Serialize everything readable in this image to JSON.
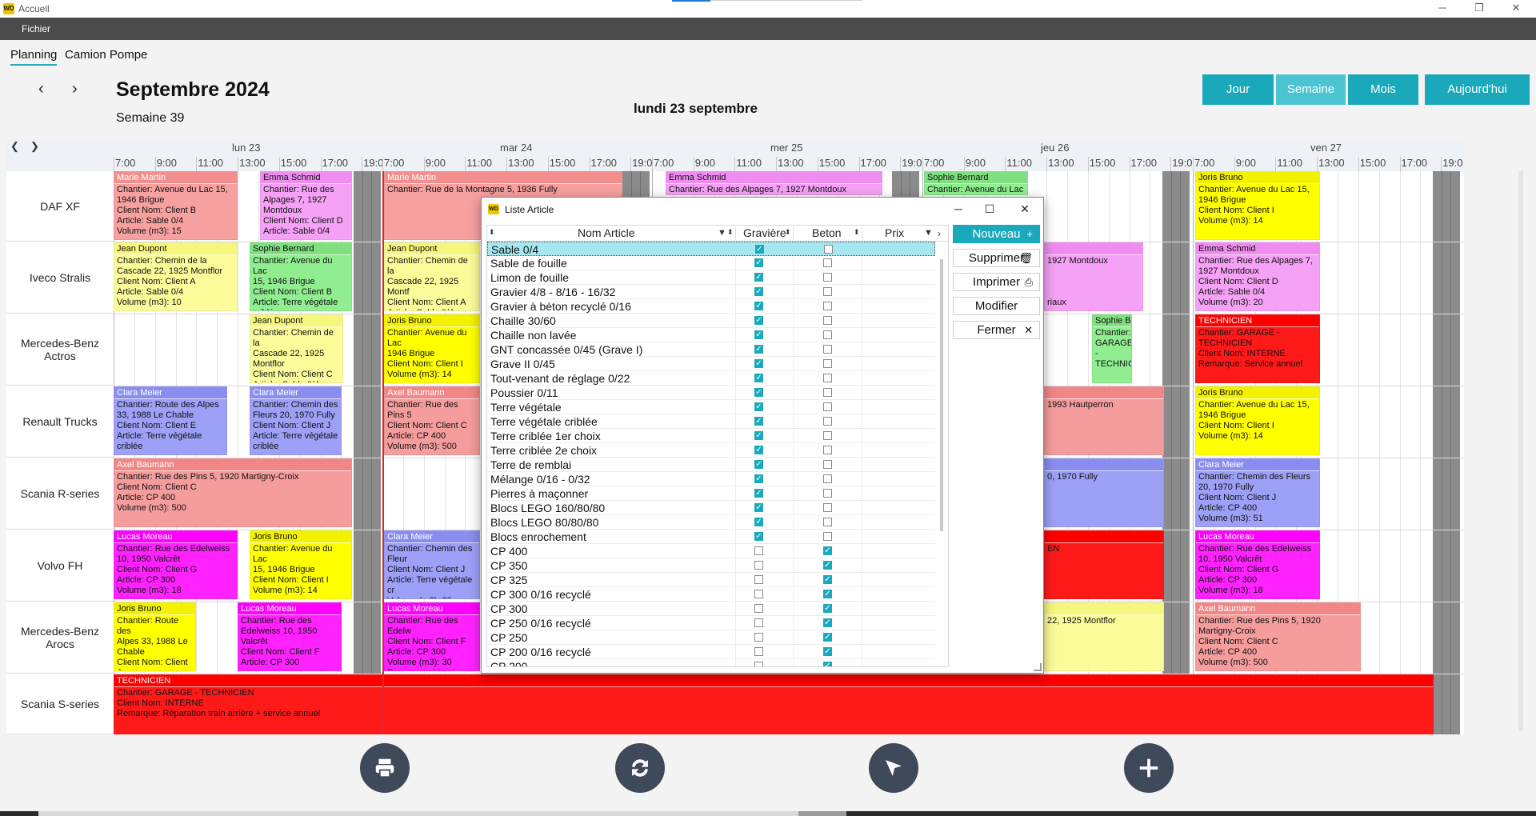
{
  "window": {
    "title": "Accueil",
    "logo": "WD"
  },
  "menu": {
    "file": "Fichier"
  },
  "tabs": [
    "Planning",
    "Camion Pompe"
  ],
  "header": {
    "month": "Septembre 2024",
    "week": "Semaine 39",
    "current_day": "lundi 23 septembre",
    "prev_icon": "‹",
    "next_icon": "›",
    "views": [
      "Jour",
      "Semaine",
      "Mois",
      "Aujourd'hui"
    ],
    "selected_view": "Semaine"
  },
  "grid": {
    "days": [
      "lun 23",
      "mar 24",
      "mer 25",
      "jeu 26",
      "ven 27"
    ],
    "hours": [
      "7:00",
      "9:00",
      "11:00",
      "13:00",
      "15:00",
      "17:00",
      "19:0"
    ],
    "rows": [
      "DAF XF",
      "Iveco Stralis",
      "Mercedes-Benz Actros",
      "Renault Trucks",
      "Scania R-series",
      "Volvo FH",
      "Mercedes-Benz Arocs",
      "Scania S-series"
    ]
  },
  "events": [
    {
      "name": "Marie Martin",
      "body": "Chantier: Avenue du Lac 15,\n1946 Brigue\nClient Nom: Client B\nArticle: Sable 0/4\nVolume (m3): 15",
      "color": "pink"
    },
    {
      "name": "Emma Schmid",
      "body": "Chantier: Rue des\nAlpages 7, 1927\nMontdoux\nClient Nom: Client D\nArticle: Sable 0/4",
      "color": "magenta"
    },
    {
      "name": "Marie Martin",
      "body": "Chantier: Rue de la Montagne 5, 1936 Fully",
      "color": "pink"
    },
    {
      "name": "Emma Schmid",
      "body": "Chantier: Rue des Alpages 7, 1927 Montdoux",
      "color": "magenta"
    },
    {
      "name": "Sophie Bernard",
      "body": "Chantier: Avenue du Lac",
      "color": "green"
    },
    {
      "name": "Joris Bruno",
      "body": "Chantier: Avenue du Lac 15,\n1946 Brigue\nClient Nom: Client I\nVolume (m3): 14",
      "color": "yellow"
    },
    {
      "name": "Jean Dupont",
      "body": "Chantier: Chemin de la\nCascade 22, 1925 Montflor\nClient Nom: Client A\nArticle: Sable 0/4\nVolume (m3): 10",
      "color": "paleyellow"
    },
    {
      "name": "Sophie Bernard",
      "body": "Chantier: Avenue du Lac\n15, 1946 Brigue\nClient Nom: Client B\nArticle: Terre végétale\ncriblée",
      "color": "green"
    },
    {
      "name": "Jean Dupont",
      "body": "Chantier: Chemin de la\nCascade 22, 1925 Montf\nClient Nom: Client A\nArticle: Sable 0/4\nVolume (m3): 10",
      "color": "paleyellow"
    },
    {
      "name": "",
      "body": "1927 Montdoux\n\n\n\nriaux",
      "color": "magenta"
    },
    {
      "name": "Emma Schmid",
      "body": "Chantier: Rue des Alpages 7,\n1927 Montdoux\nClient Nom: Client D\nArticle: Sable 0/4\nVolume (m3): 20",
      "color": "magenta"
    },
    {
      "name": "Jean Dupont",
      "body": "Chantier: Chemin de la\nCascade 22, 1925\nMontflor\nClient Nom: Client C\nArticle: Sable 0/4",
      "color": "paleyellow"
    },
    {
      "name": "Joris Bruno",
      "body": "Chantier: Avenue du Lac\n1946 Brigue\nClient Nom: Client I\nVolume (m3): 14",
      "color": "yellow"
    },
    {
      "name": "Sophie Bernard",
      "body": "Chantier:\nGARAGE\n-\nTECHNICI",
      "color": "green"
    },
    {
      "name": "TECHNICIEN",
      "body": "Chantier: GARAGE -\nTECHNICIEN\nClient Nom: INTERNE\nRemarque: Service annuel",
      "color": "red"
    },
    {
      "name": "Clara Meier",
      "body": "Chantier: Route des Alpes\n33, 1988 Le Chable\nClient Nom: Client E\nArticle: Terre végétale\ncriblée",
      "color": "blue"
    },
    {
      "name": "Clara Meier",
      "body": "Chantier: Chemin des\nFleurs 20, 1970 Fully\nClient Nom: Client J\nArticle: Terre végétale\ncriblée",
      "color": "blue"
    },
    {
      "name": "Axel Baumann",
      "body": "Chantier: Rue des Pins 5\nClient Nom: Client C\nArticle: CP 400\nVolume (m3): 500",
      "color": "salmon"
    },
    {
      "name": "",
      "body": "1993 Hautperron",
      "color": "salmon"
    },
    {
      "name": "Joris Bruno",
      "body": "Chantier: Avenue du Lac 15,\n1946 Brigue\nClient Nom: Client I\nVolume (m3): 14",
      "color": "yellow"
    },
    {
      "name": "Axel Baumann",
      "body": "Chantier: Rue des Pins 5, 1920 Martigny-Croix\nClient Nom: Client C\nArticle: CP 400\nVolume (m3): 500",
      "color": "salmon"
    },
    {
      "name": "",
      "body": "0, 1970 Fully",
      "color": "blue"
    },
    {
      "name": "Clara Meier",
      "body": "Chantier: Chemin des Fleurs\n20, 1970 Fully\nClient Nom: Client J\nArticle: CP 400\nVolume (m3): 51",
      "color": "blue"
    },
    {
      "name": "Lucas Moreau",
      "body": "Chantier: Rue des Edelweiss\n10, 1950 Valcrêt\nClient Nom: Client G\nArticle: CP 300\nVolume (m3): 18",
      "color": "hotpink"
    },
    {
      "name": "Joris Bruno",
      "body": "Chantier: Avenue du Lac\n15, 1946 Brigue\nClient Nom: Client I\nVolume (m3): 14",
      "color": "yellow"
    },
    {
      "name": "Clara Meier",
      "body": "Chantier: Chemin des Fleur\nClient Nom: Client J\nArticle: Terre végétale cr\nVolume (m3): 28\nRemarque: Livraison de",
      "color": "blue"
    },
    {
      "name": "",
      "body": "EN",
      "color": "red"
    },
    {
      "name": "Lucas Moreau",
      "body": "Chantier: Rue des Edelweiss\n10, 1950 Valcrêt\nClient Nom: Client G\nArticle: CP 300\nVolume (m3): 18",
      "color": "hotpink"
    },
    {
      "name": "Joris Bruno",
      "body": "Chantier: Route des\nAlpes 33, 1988 Le\nChable\nClient Nom: Client A\nArticle: Sable 0/4",
      "color": "yellow"
    },
    {
      "name": "Lucas Moreau",
      "body": "Chantier: Rue des\nEdelweiss 10, 1950\nValcrêt\nClient Nom: Client F\nArticle: CP 300",
      "color": "hotpink"
    },
    {
      "name": "Lucas Moreau",
      "body": "Chantier: Rue des Edelw\nClient Nom: Client F\nArticle: CP 300\nVolume (m3): 30\nRemarque: Livraison de",
      "color": "hotpink"
    },
    {
      "name": "",
      "body": "22, 1925 Montflor",
      "color": "paleyellow"
    },
    {
      "name": "Axel Baumann",
      "body": "Chantier: Rue des Pins 5, 1920\nMartigny-Croix\nClient Nom: Client C\nArticle: CP 400\nVolume (m3): 500",
      "color": "salmon"
    },
    {
      "name": "TECHNICIEN",
      "body": "Chantier: GARAGE - TECHNICIEN\nClient Nom: INTERNE\nRemarque: Réparation train arrière + service annuel",
      "color": "red"
    }
  ],
  "dialog": {
    "title": "Liste Article",
    "columns": [
      "Nom Article",
      "Gravière",
      "Beton",
      "Prix"
    ],
    "rows": [
      {
        "name": "Sable 0/4",
        "graviere": true,
        "beton": false
      },
      {
        "name": "Sable de fouille",
        "graviere": true,
        "beton": false
      },
      {
        "name": "Limon de fouille",
        "graviere": true,
        "beton": false
      },
      {
        "name": "Gravier 4/8 - 8/16 - 16/32",
        "graviere": true,
        "beton": false
      },
      {
        "name": "Gravier à béton recyclé 0/16",
        "graviere": true,
        "beton": false
      },
      {
        "name": "Chaille 30/60",
        "graviere": true,
        "beton": false
      },
      {
        "name": "Chaille non lavée",
        "graviere": true,
        "beton": false
      },
      {
        "name": "GNT concassée 0/45 (Grave I)",
        "graviere": true,
        "beton": false
      },
      {
        "name": "Grave II 0/45",
        "graviere": true,
        "beton": false
      },
      {
        "name": "Tout-venant de réglage 0/22",
        "graviere": true,
        "beton": false
      },
      {
        "name": "Poussier 0/11",
        "graviere": true,
        "beton": false
      },
      {
        "name": "Terre végétale",
        "graviere": true,
        "beton": false
      },
      {
        "name": "Terre végétale criblée",
        "graviere": true,
        "beton": false
      },
      {
        "name": "Terre criblée 1er choix",
        "graviere": true,
        "beton": false
      },
      {
        "name": "Terre criblée 2e choix",
        "graviere": true,
        "beton": false
      },
      {
        "name": "Terre de remblai",
        "graviere": true,
        "beton": false
      },
      {
        "name": "Mélange 0/16 - 0/32",
        "graviere": true,
        "beton": false
      },
      {
        "name": "Pierres à maçonner",
        "graviere": true,
        "beton": false
      },
      {
        "name": "Blocs LEGO 160/80/80",
        "graviere": true,
        "beton": false
      },
      {
        "name": "Blocs LEGO 80/80/80",
        "graviere": true,
        "beton": false
      },
      {
        "name": "Blocs enrochement",
        "graviere": true,
        "beton": false
      },
      {
        "name": "CP 400",
        "graviere": false,
        "beton": true
      },
      {
        "name": "CP 350",
        "graviere": false,
        "beton": true
      },
      {
        "name": "CP 325",
        "graviere": false,
        "beton": true
      },
      {
        "name": "CP 300 0/16 recyclé",
        "graviere": false,
        "beton": true
      },
      {
        "name": "CP 300",
        "graviere": false,
        "beton": true
      },
      {
        "name": "CP 250 0/16 recyclé",
        "graviere": false,
        "beton": true
      },
      {
        "name": "CP 250",
        "graviere": false,
        "beton": true
      },
      {
        "name": "CP 200 0/16 recyclé",
        "graviere": false,
        "beton": true
      },
      {
        "name": "CP 200",
        "graviere": false,
        "beton": true
      }
    ],
    "buttons": {
      "new": "Nouveau",
      "new_icon": "+",
      "delete": "Supprimer",
      "delete_icon": "🗑",
      "print": "Imprimer",
      "print_icon": "⎙",
      "edit": "Modifier",
      "close": "Fermer",
      "close_icon": "✕"
    }
  },
  "toolbar": {
    "print_icon": "printer-icon",
    "refresh_icon": "refresh-icon",
    "select_icon": "cursor-icon",
    "add_icon": "plus-icon"
  }
}
